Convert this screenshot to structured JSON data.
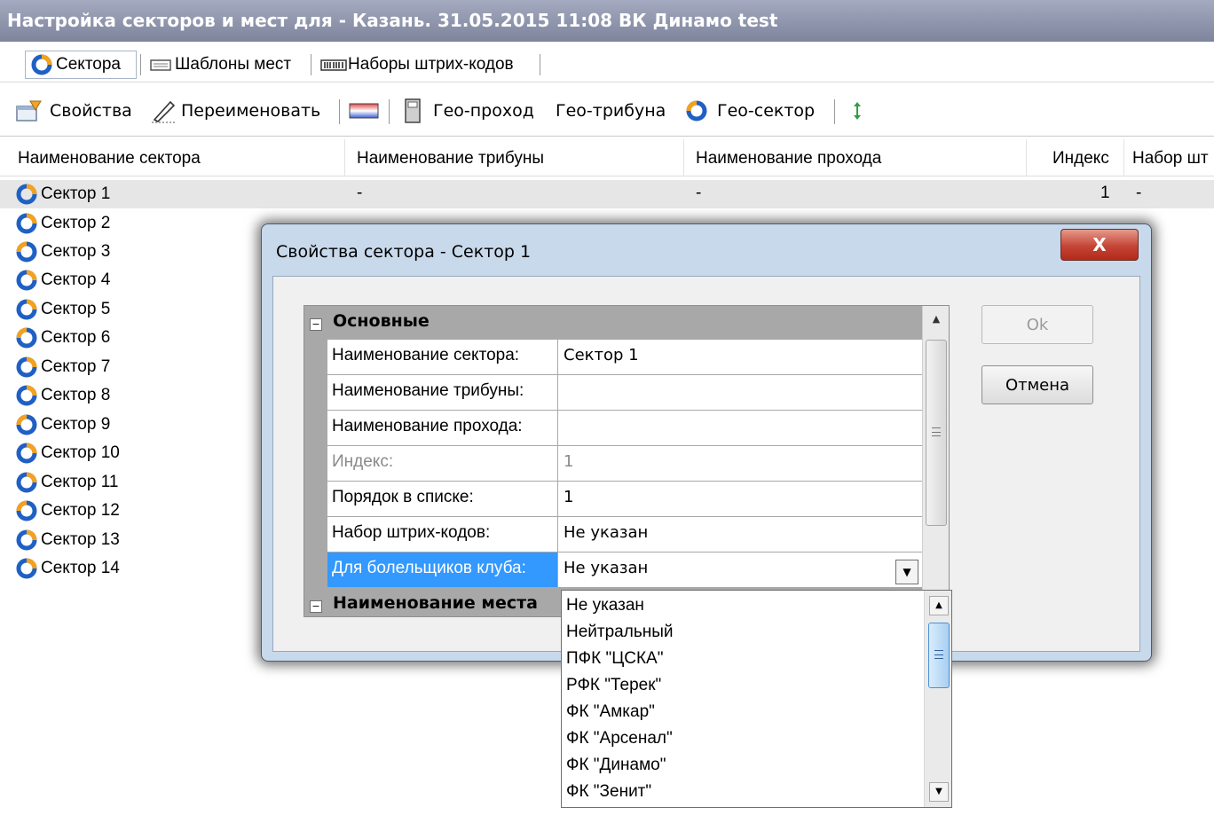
{
  "window": {
    "title": "Настройка секторов и мест для - Казань. 31.05.2015 11:08 ВК Динамо test"
  },
  "tabs": [
    {
      "label": "Сектора",
      "icon": "sector-icon"
    },
    {
      "label": "Шаблоны мест",
      "icon": "seat-template-icon"
    },
    {
      "label": "Наборы штрих-кодов",
      "icon": "barcode-icon"
    }
  ],
  "toolbar": {
    "properties": "Свойства",
    "rename": "Переименовать",
    "geo_pass": "Гео-проход",
    "geo_tribune": "Гео-трибуна",
    "geo_sector": "Гео-сектор"
  },
  "list": {
    "columns": [
      "Наименование сектора",
      "Наименование трибуны",
      "Наименование прохода",
      "Индекс",
      "Набор шт"
    ],
    "rows": [
      {
        "name": "Сектор 1",
        "tribune": "-",
        "pass": "-",
        "index": "1",
        "set": "-"
      },
      {
        "name": "Сектор 2"
      },
      {
        "name": "Сектор 3"
      },
      {
        "name": "Сектор 4"
      },
      {
        "name": "Сектор 5"
      },
      {
        "name": "Сектор 6"
      },
      {
        "name": "Сектор 7"
      },
      {
        "name": "Сектор 8"
      },
      {
        "name": "Сектор 9"
      },
      {
        "name": "Сектор 10"
      },
      {
        "name": "Сектор 11"
      },
      {
        "name": "Сектор 12"
      },
      {
        "name": "Сектор 13"
      },
      {
        "name": "Сектор 14"
      }
    ]
  },
  "dialog": {
    "title": "Свойства сектора - Сектор 1",
    "close": "X",
    "ok": "Ok",
    "cancel": "Отмена",
    "category_main": "Основные",
    "category_seat": "Наименование места",
    "props": [
      {
        "name": "Наименование сектора:",
        "value": "Сектор 1"
      },
      {
        "name": "Наименование трибуны:",
        "value": ""
      },
      {
        "name": "Наименование прохода:",
        "value": ""
      },
      {
        "name": "Индекс:",
        "value": "1"
      },
      {
        "name": "Порядок в списке:",
        "value": "1"
      },
      {
        "name": "Набор штрих-кодов:",
        "value": "Не указан"
      },
      {
        "name": "Для болельщиков клуба:",
        "value": "Не указан"
      }
    ]
  },
  "dropdown": {
    "options": [
      "Не указан",
      "Нейтральный",
      "ПФК \"ЦСКА\"",
      "РФК \"Терек\"",
      "ФК \"Амкар\"",
      "ФК \"Арсенал\"",
      "ФК \"Динамо\"",
      "ФК \"Зенит\""
    ]
  },
  "colors": {
    "title_bar": "#7d849c",
    "selection": "#3399ff",
    "category_band": "#a8a8a8",
    "close_button": "#c44536"
  }
}
